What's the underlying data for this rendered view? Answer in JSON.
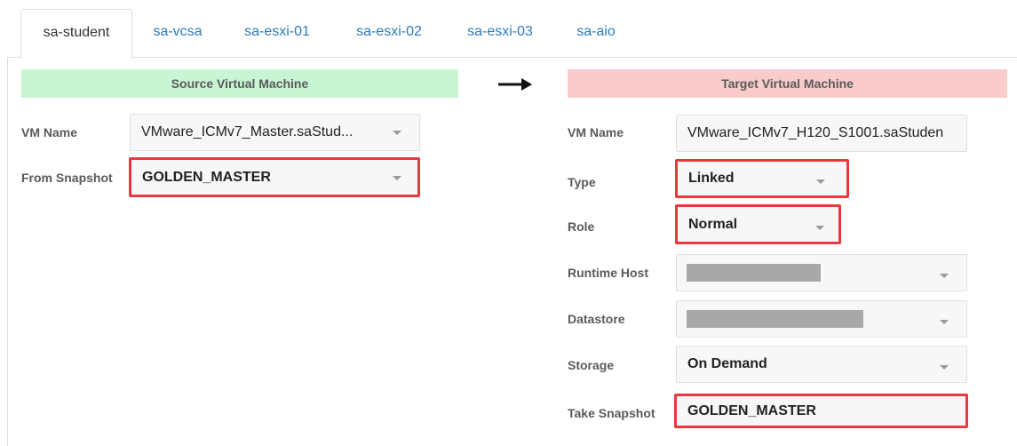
{
  "tabs": [
    {
      "label": "sa-student",
      "active": true
    },
    {
      "label": "sa-vcsa",
      "active": false
    },
    {
      "label": "sa-esxi-01",
      "active": false
    },
    {
      "label": "sa-esxi-02",
      "active": false
    },
    {
      "label": "sa-esxi-03",
      "active": false
    },
    {
      "label": "sa-aio",
      "active": false
    }
  ],
  "source": {
    "heading": "Source Virtual Machine",
    "vm_name_label": "VM Name",
    "vm_name_value": "VMware_ICMv7_Master.saStud...",
    "snapshot_label": "From Snapshot",
    "snapshot_value": "GOLDEN_MASTER"
  },
  "target": {
    "heading": "Target Virtual Machine",
    "vm_name_label": "VM Name",
    "vm_name_value": "VMware_ICMv7_H120_S1001.saStuden",
    "type_label": "Type",
    "type_value": "Linked",
    "role_label": "Role",
    "role_value": "Normal",
    "runtime_host_label": "Runtime Host",
    "datastore_label": "Datastore",
    "storage_label": "Storage",
    "storage_value": "On Demand",
    "take_snapshot_label": "Take Snapshot",
    "take_snapshot_value": "GOLDEN_MASTER"
  },
  "icons": {
    "arrow": "arrow-right-icon",
    "caret": "chevron-down-icon"
  },
  "colors": {
    "source_head_bg": "#c8f5d4",
    "target_head_bg": "#f9cccb",
    "highlight_border": "#e8393f",
    "tab_link": "#2a7bc3"
  }
}
